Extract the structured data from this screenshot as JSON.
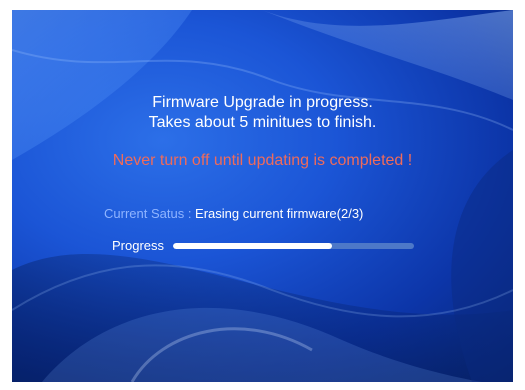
{
  "screen": {
    "title_line1": "Firmware Upgrade in progress.",
    "title_line2": "Takes about 5 minitues to finish.",
    "warning": "Never turn off until updating is completed !",
    "status": {
      "label": "Current Satus",
      "separator": " : ",
      "value": "Erasing current firmware(2/3)"
    },
    "progress": {
      "label": "Progress",
      "fraction": 0.66
    }
  },
  "colors": {
    "warning": "#ef6b5b",
    "status_label": "#8fb4ff",
    "progress_fill": "#ffffff",
    "progress_track": "#4d78c8"
  }
}
